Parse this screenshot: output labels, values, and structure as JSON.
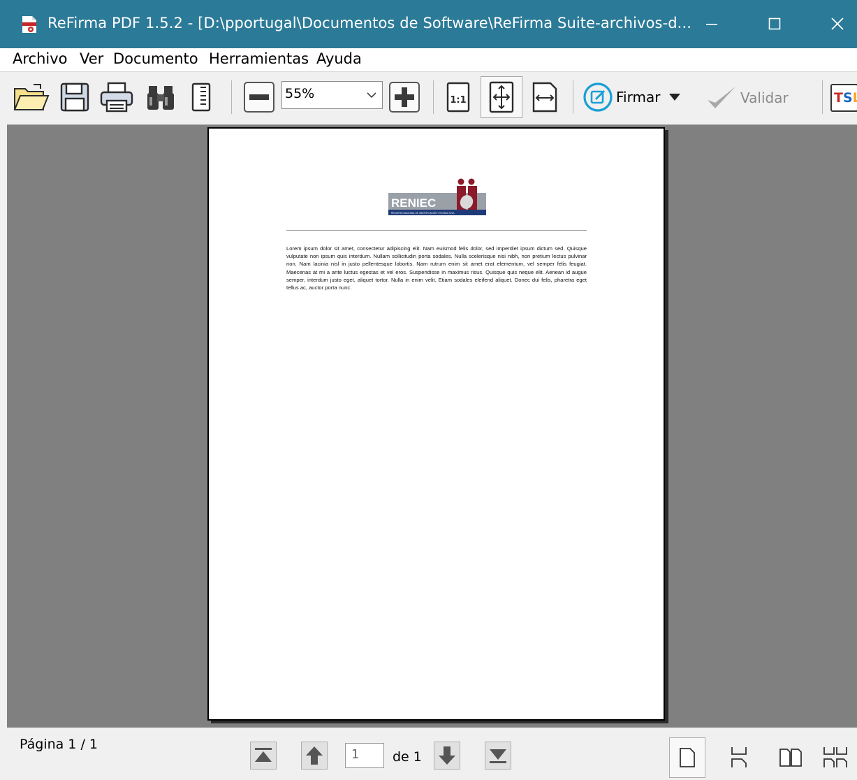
{
  "window": {
    "title": "ReFirma PDF 1.5.2 - [D:\\pportugal\\Documentos de Software\\ReFirma Suite-archivos-d...",
    "app_icon": "refirma-app-icon",
    "controls": [
      "minimize-icon",
      "maximize-icon",
      "close-icon"
    ]
  },
  "menu": {
    "items": [
      "Archivo",
      "Ver",
      "Documento",
      "Herramientas",
      "Ayuda"
    ]
  },
  "toolbar": {
    "icons": [
      "open-folder-icon",
      "save-icon",
      "print-icon",
      "binoculars-icon",
      "document-properties-icon"
    ],
    "zoom_value": "55%",
    "zoom_icons": [
      "zoom-out-icon",
      "zoom-in-icon"
    ],
    "fit_icons": [
      "actual-size-icon",
      "fit-page-icon",
      "fit-width-icon"
    ],
    "actual_size_label": "1:1",
    "firmar_label": "Firmar",
    "validar_label": "Validar",
    "tsl_label": "TSL"
  },
  "document": {
    "logo_text": "RENIEC",
    "logo_subtext": "REGISTRO NACIONAL DE IDENTIFICACIÓN Y ESTADO CIVIL",
    "body": "Lorem ipsum dolor sit amet, consectetur adipiscing elit. Nam euismod felis dolor, sed imperdiet ipsum dictum sed. Quisque vulputate non ipsum quis interdum. Nullam sollicitudin porta sodales. Nulla scelerisque nisi nibh, non pretium lectus pulvinar non. Nam lacinia nisl in justo pellentesque lobortis. Nam rutrum enim sit amet erat elementum, vel semper felis feugiat. Maecenas at mi a ante luctus egestas et vel eros. Suspendisse in maximus risus. Quisque quis neque elit. Aenean id augue semper, interdum justo eget, aliquet tortor. Nulla in enim velit. Etiam sodales eleifend aliquet. Donec dui felis, pharetra eget tellus ac, auctor porta nunc."
  },
  "status": {
    "page_label": "Página 1 / 1",
    "page_input": "1",
    "page_of": "de 1",
    "nav_icons": [
      "first-page-icon",
      "previous-page-icon",
      "next-page-icon",
      "last-page-icon"
    ],
    "view_mode_icons": [
      "single-page-icon",
      "continuous-page-icon",
      "facing-pages-icon",
      "continuous-facing-icon"
    ]
  },
  "colors": {
    "titlebar": "#2b7a98",
    "viewer_bg": "#808080",
    "logo_red": "#8b1a2b",
    "logo_blue": "#1e3a78"
  }
}
